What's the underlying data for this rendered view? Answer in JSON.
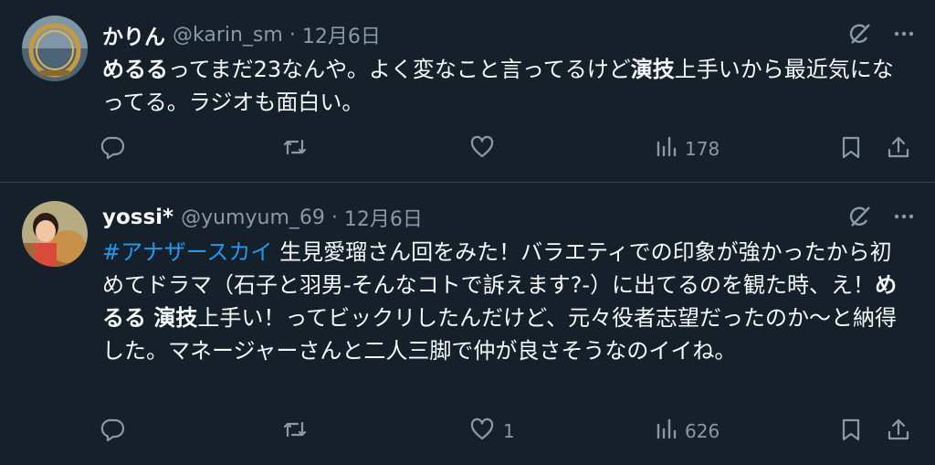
{
  "tweets": [
    {
      "display_name": "かりん",
      "handle": "@karin_sm",
      "separator": "·",
      "date": "12月6日",
      "body": {
        "seg1": "めるる",
        "seg2": "ってまだ23なんや。よく変なこと言ってるけど",
        "seg3": "演技",
        "seg4": "上手いから最近気になってる。ラジオも面白い。"
      },
      "reply_count": "",
      "retweet_count": "",
      "like_count": "",
      "view_count": "178"
    },
    {
      "display_name": "yossi*",
      "handle": "@yumyum_69",
      "separator": "·",
      "date": "12月6日",
      "body": {
        "hashtag": "#アナザースカイ",
        "seg1": " 生見愛瑠さん回をみた！バラエティでの印象が強かったから初めてドラマ（石子と羽男-そんなコトで訴えます?-）に出てるのを観た時、え！",
        "seg2": "めるる 演技",
        "seg3": "上手い！ってビックリしたんだけど、元々役者志望だったのか〜と納得した。マネージャーさんと二人三脚で仲が良さそうなのイイね。"
      },
      "reply_count": "",
      "retweet_count": "",
      "like_count": "1",
      "view_count": "626"
    }
  ],
  "icons": {
    "grok": "grok-icon",
    "more": "more-icon",
    "reply": "reply-icon",
    "retweet": "retweet-icon",
    "like": "heart-icon",
    "views": "views-icon",
    "bookmark": "bookmark-icon",
    "share": "share-icon"
  },
  "colors": {
    "background": "#15202b",
    "text": "#f7f9f9",
    "secondary": "#8b98a5",
    "hashtag": "#1d9bf0",
    "separator": "#38444d"
  }
}
